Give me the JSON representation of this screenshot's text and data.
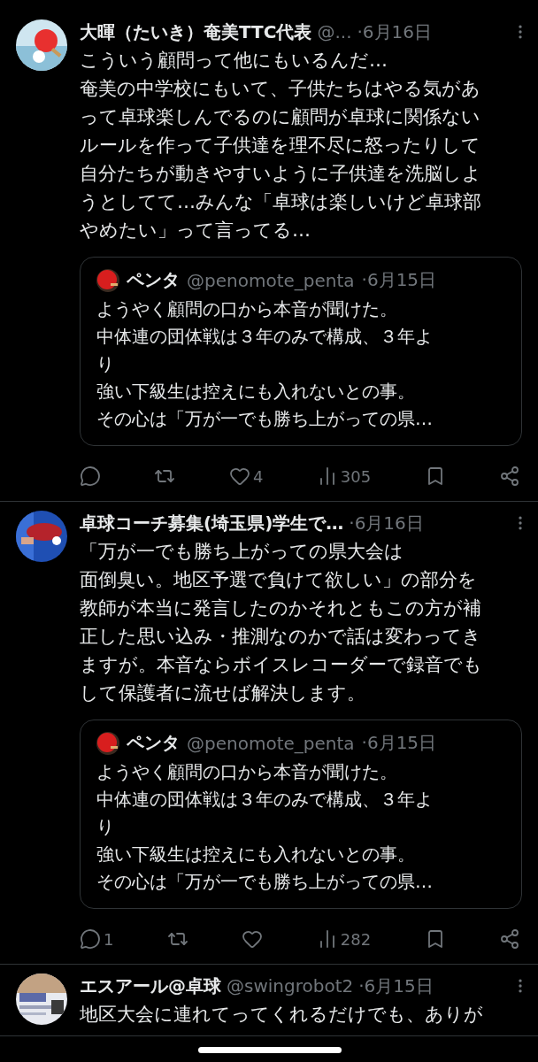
{
  "tweets": [
    {
      "name": "大暉（たいき）奄美TTC代表",
      "handle": "@...",
      "date": "·6月16日",
      "lines": [
        "こういう顧問って他にもいるんだ…",
        "奄美の中学校にもいて、子供たちはやる気があ",
        "って卓球楽しんでるのに顧問が卓球に関係ない",
        "ルールを作って子供達を理不尽に怒ったりして",
        "自分たちが動きやすいように子供達を洗脳しよ",
        "うとしてて…みんな「卓球は楽しいけど卓球部",
        "やめたい」って言ってる…"
      ],
      "quote": {
        "name": "ペンタ",
        "handle": "@penomote_penta",
        "date": "·6月15日",
        "lines": [
          "ようやく顧問の口から本音が聞けた。",
          "中体連の団体戦は３年のみで構成、３年よ",
          "り",
          "強い下級生は控えにも入れないとの事。",
          "その心は「万が一でも勝ち上がっての県…"
        ]
      },
      "actions": [
        {
          "kind": "reply"
        },
        {
          "kind": "repost"
        },
        {
          "kind": "like",
          "count": "4"
        },
        {
          "kind": "views",
          "count": "305"
        },
        {
          "kind": "bookmark"
        },
        {
          "kind": "share"
        }
      ]
    },
    {
      "name": "卓球コーチ募集(埼玉県)学生で…",
      "date": "·6月16日",
      "lines": [
        "「万が一でも勝ち上がっての県大会は",
        "面倒臭い。地区予選で負けて欲しい」の部分を",
        "教師が本当に発言したのかそれともこの方が補",
        "正した思い込み・推測なのかで話は変わってき",
        "ますが。本音ならボイスレコーダーで録音でも",
        "して保護者に流せば解決します。"
      ],
      "quote": {
        "name": "ペンタ",
        "handle": "@penomote_penta",
        "date": "·6月15日",
        "lines": [
          "ようやく顧問の口から本音が聞けた。",
          "中体連の団体戦は３年のみで構成、３年よ",
          "り",
          "強い下級生は控えにも入れないとの事。",
          "その心は「万が一でも勝ち上がっての県…"
        ]
      },
      "actions": [
        {
          "kind": "reply",
          "count": "1"
        },
        {
          "kind": "repost"
        },
        {
          "kind": "like"
        },
        {
          "kind": "views",
          "count": "282"
        },
        {
          "kind": "bookmark"
        },
        {
          "kind": "share"
        }
      ]
    },
    {
      "name": "エスアール@卓球",
      "handle": "@swingrobot2",
      "date": "·6月15日",
      "lines": [
        "地区大会に連れてってくれるだけでも、ありが"
      ]
    }
  ]
}
